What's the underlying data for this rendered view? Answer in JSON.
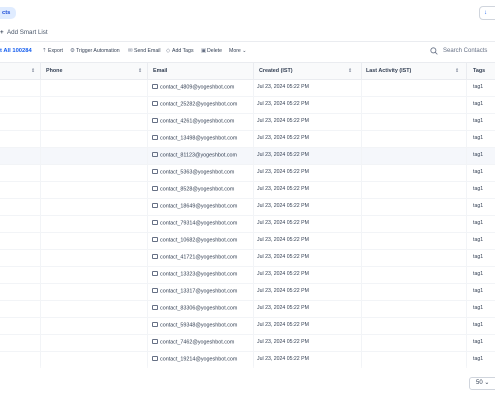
{
  "header": {
    "tab_label": "cts",
    "right_button": "↓ "
  },
  "smartlist": {
    "add_label": "Add Smart List",
    "plus": "+"
  },
  "toolbar": {
    "all_label": "t All 100284",
    "actions": [
      {
        "label": "Export",
        "icon": "export-icon",
        "glyph": "⇡"
      },
      {
        "label": "Trigger Automation",
        "icon": "automation-icon",
        "glyph": "⚙"
      },
      {
        "label": "Send Email",
        "icon": "email-icon",
        "glyph": "✉"
      },
      {
        "label": "Add Tags",
        "icon": "tag-icon",
        "glyph": "◇"
      },
      {
        "label": "Delete",
        "icon": "trash-icon",
        "glyph": "▣"
      },
      {
        "label": "More ⌄",
        "icon": "",
        "glyph": ""
      }
    ],
    "search_placeholder": "Search Contacts"
  },
  "table": {
    "headers": {
      "phone": "Phone",
      "email": "Email",
      "created": "Created (IST)",
      "last_activity": "Last Activity (IST)",
      "tags": "Tags"
    },
    "rows": [
      {
        "email": "contact_4809@yogeshbot.com",
        "created": "Jul 23, 2024 05:22 PM",
        "tag": "tag1"
      },
      {
        "email": "contact_25282@yogeshbot.com",
        "created": "Jul 23, 2024 05:22 PM",
        "tag": "tag1"
      },
      {
        "email": "contact_4261@yogeshbot.com",
        "created": "Jul 23, 2024 05:22 PM",
        "tag": "tag1"
      },
      {
        "email": "contact_13498@yogeshbot.com",
        "created": "Jul 23, 2024 05:22 PM",
        "tag": "tag1"
      },
      {
        "email": "contact_81123@yogeshbot.com",
        "created": "Jul 23, 2024 05:22 PM",
        "tag": "tag1"
      },
      {
        "email": "contact_5363@yogeshbot.com",
        "created": "Jul 23, 2024 05:22 PM",
        "tag": "tag1"
      },
      {
        "email": "contact_8528@yogeshbot.com",
        "created": "Jul 23, 2024 05:22 PM",
        "tag": "tag1"
      },
      {
        "email": "contact_18649@yogeshbot.com",
        "created": "Jul 23, 2024 05:22 PM",
        "tag": "tag1"
      },
      {
        "email": "contact_79314@yogeshbot.com",
        "created": "Jul 23, 2024 05:22 PM",
        "tag": "tag1"
      },
      {
        "email": "contact_10682@yogeshbot.com",
        "created": "Jul 23, 2024 05:22 PM",
        "tag": "tag1"
      },
      {
        "email": "contact_41721@yogeshbot.com",
        "created": "Jul 23, 2024 05:22 PM",
        "tag": "tag1"
      },
      {
        "email": "contact_13323@yogeshbot.com",
        "created": "Jul 23, 2024 05:22 PM",
        "tag": "tag1"
      },
      {
        "email": "contact_13317@yogeshbot.com",
        "created": "Jul 23, 2024 05:22 PM",
        "tag": "tag1"
      },
      {
        "email": "contact_83306@yogeshbot.com",
        "created": "Jul 23, 2024 05:22 PM",
        "tag": "tag1"
      },
      {
        "email": "contact_59348@yogeshbot.com",
        "created": "Jul 23, 2024 05:22 PM",
        "tag": "tag1"
      },
      {
        "email": "contact_7462@yogeshbot.com",
        "created": "Jul 23, 2024 05:22 PM",
        "tag": "tag1"
      },
      {
        "email": "contact_19214@yogeshbot.com",
        "created": "Jul 23, 2024 05:22 PM",
        "tag": "tag1"
      }
    ]
  },
  "footer": {
    "page_size": "50 ⌄"
  }
}
